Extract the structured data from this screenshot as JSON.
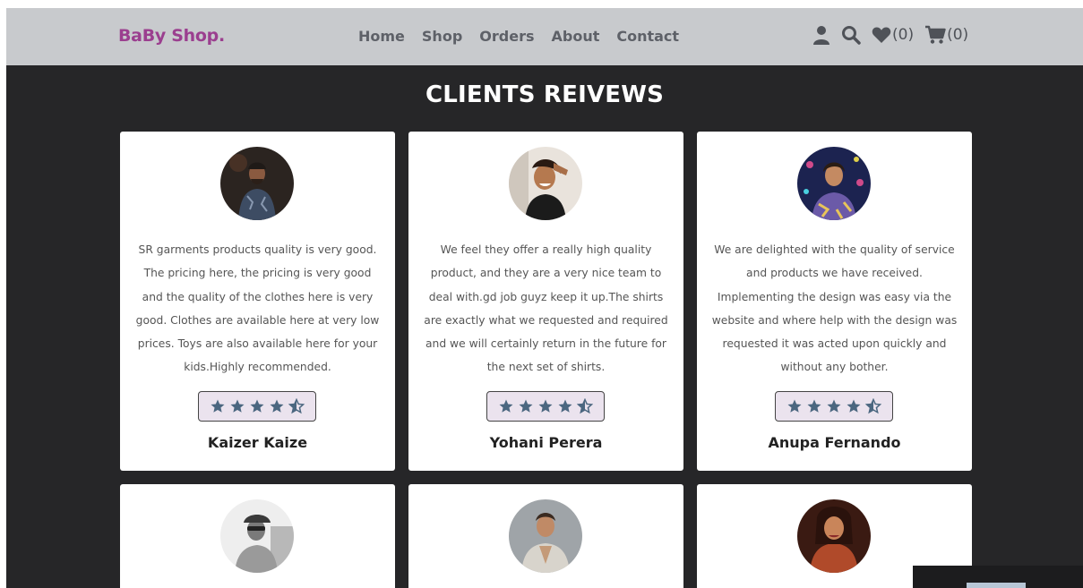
{
  "brand": {
    "name": "BaBy Shop",
    "dot": "."
  },
  "nav": {
    "links": [
      "Home",
      "Shop",
      "Orders",
      "About",
      "Contact"
    ]
  },
  "header_icons": {
    "user": "user-icon",
    "search": "search-icon",
    "wishlist": "heart-icon",
    "wishlist_count": "(0)",
    "cart": "cart-icon",
    "cart_count": "(0)"
  },
  "section": {
    "title": "CLIENTS REIVEWS"
  },
  "reviews": [
    {
      "name": "Kaizer Kaize",
      "rating": 4.5,
      "text": "SR garments products quality is very good. The pricing here, the pricing is very good and the quality of the clothes here is very good. Clothes are available here at very low prices. Toys are also available here for your kids.Highly recommended."
    },
    {
      "name": "Yohani Perera",
      "rating": 4.5,
      "text": "We feel they offer a really high quality product, and they are a very nice team to deal with.gd job guyz keep it up.The shirts are exactly what we requested and required and we will certainly return in the future for the next set of shirts."
    },
    {
      "name": "Anupa Fernando",
      "rating": 4.5,
      "text": "We are delighted with the quality of service and products we have received. Implementing the design was easy via the website and where help with the design was requested it was acted upon quickly and without any bother."
    }
  ],
  "colors": {
    "brand": "#9b3f8f",
    "navbar_bg": "#c8cacd",
    "section_bg": "#262628",
    "star": "#4b6780",
    "rating_box_bg": "#ebe3ee"
  }
}
